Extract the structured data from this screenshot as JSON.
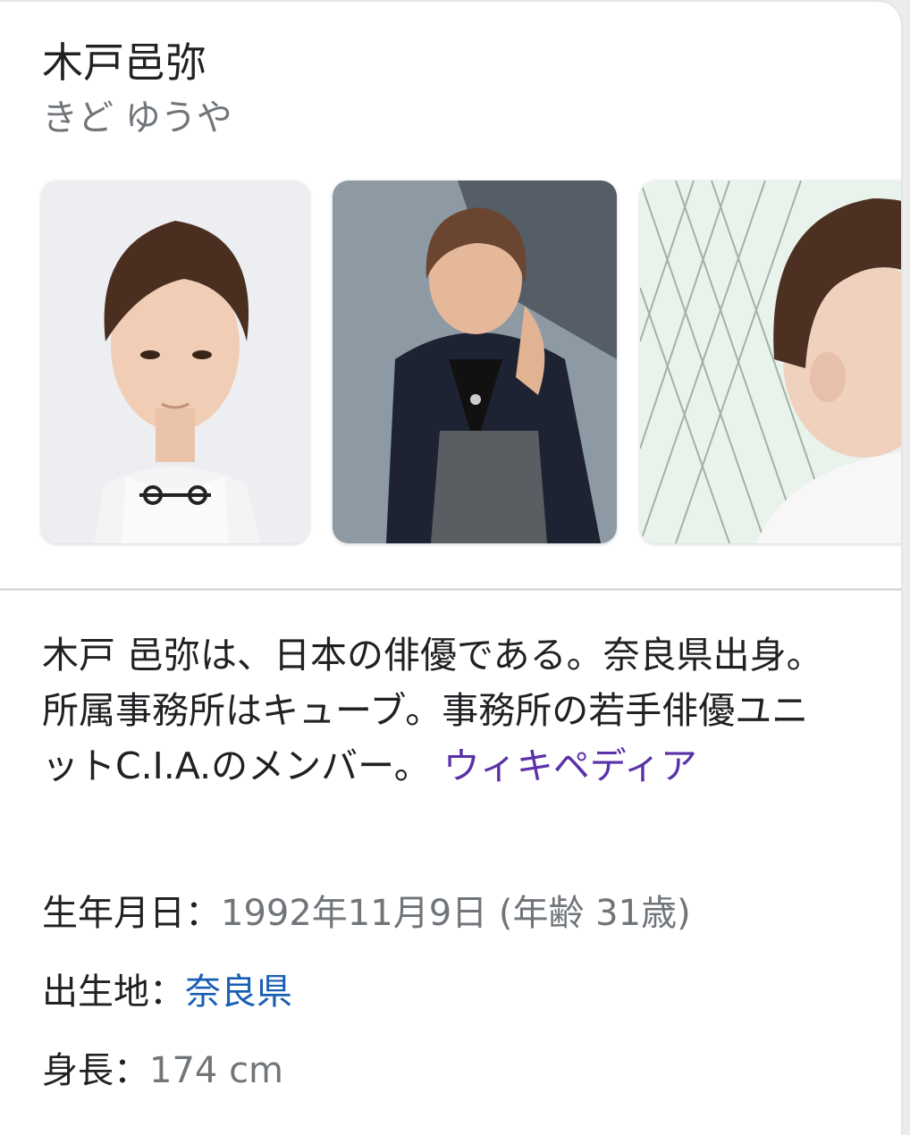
{
  "header": {
    "name": "木戸邑弥",
    "reading": "きど ゆうや"
  },
  "description": {
    "line1": "木戸 邑弥は、日本の俳優である。奈良県出身。",
    "line2": "所属事務所はキューブ。事務所の若手俳優ユニットC.I.A.のメンバー。",
    "source_link": "ウィキペディア"
  },
  "facts": {
    "birth_label": "生年月日：",
    "birth_value": "1992年11月9日 (年齢 31歳)",
    "birthplace_label": "出生地：",
    "birthplace_value": "奈良県",
    "height_label": "身長：",
    "height_value": "174 cm"
  },
  "colors": {
    "visited_link": "#5a31a8",
    "link": "#1a5fb4",
    "secondary_text": "#70757a"
  }
}
